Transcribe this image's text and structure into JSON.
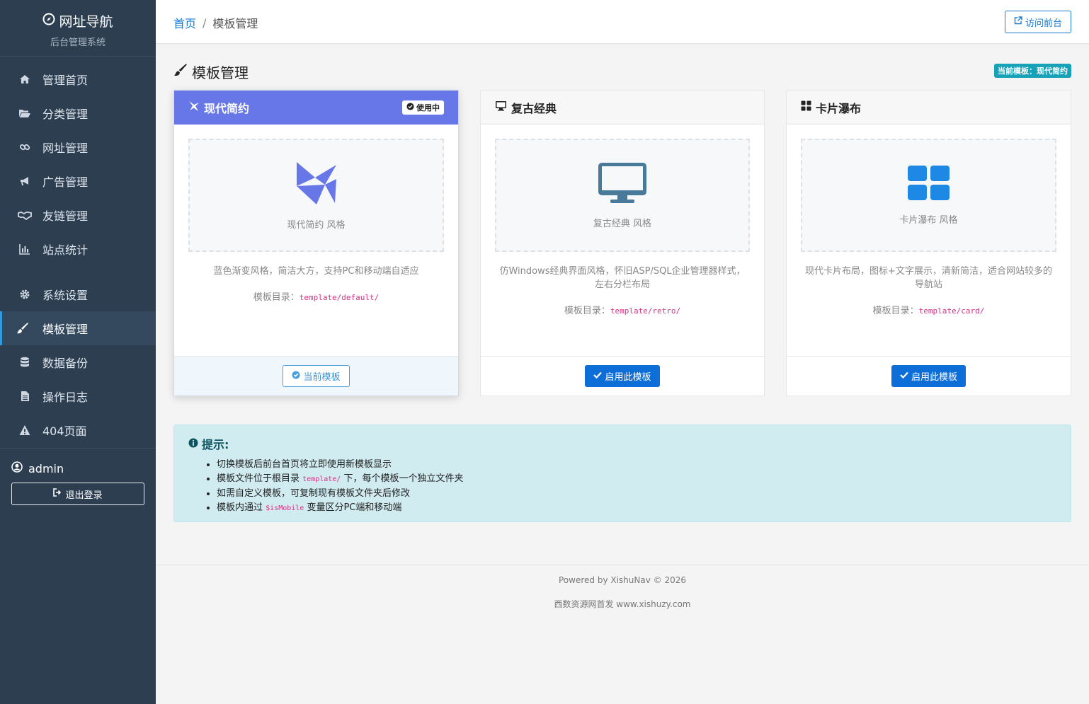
{
  "brand": {
    "title": "网址导航",
    "subtitle": "后台管理系统"
  },
  "nav": [
    {
      "label": "管理首页",
      "icon": "home-icon"
    },
    {
      "label": "分类管理",
      "icon": "folder-open-icon"
    },
    {
      "label": "网址管理",
      "icon": "link-icon"
    },
    {
      "label": "广告管理",
      "icon": "bullhorn-icon"
    },
    {
      "label": "友链管理",
      "icon": "handshake-icon"
    },
    {
      "label": "站点统计",
      "icon": "bar-chart-icon"
    },
    {
      "label": "系统设置",
      "icon": "gear-icon"
    },
    {
      "label": "模板管理",
      "icon": "paint-brush-icon",
      "active": true
    },
    {
      "label": "数据备份",
      "icon": "database-icon"
    },
    {
      "label": "操作日志",
      "icon": "file-text-icon"
    },
    {
      "label": "404页面",
      "icon": "warning-icon"
    }
  ],
  "user": {
    "name": "admin",
    "logout_label": "退出登录"
  },
  "header": {
    "breadcrumb_home": "首页",
    "breadcrumb_sep": "/",
    "breadcrumb_current": "模板管理",
    "visit_label": "访问前台"
  },
  "page": {
    "title": "模板管理",
    "current_badge": "当前模板：现代简约"
  },
  "templates": [
    {
      "name": "现代简约",
      "status_tag": "使用中",
      "preview_label": "现代简约 风格",
      "description": "蓝色渐变风格，简洁大方，支持PC和移动端自适应",
      "dir_label": "模板目录：",
      "dir_path": "template/default/",
      "button_label": "当前模板"
    },
    {
      "name": "复古经典",
      "preview_label": "复古经典 风格",
      "description": "仿Windows经典界面风格，怀旧ASP/SQL企业管理器样式，左右分栏布局",
      "dir_label": "模板目录：",
      "dir_path": "template/retro/",
      "button_label": "启用此模板"
    },
    {
      "name": "卡片瀑布",
      "preview_label": "卡片瀑布 风格",
      "description": "现代卡片布局，图标+文字展示，清新简洁，适合网站较多的导航站",
      "dir_label": "模板目录：",
      "dir_path": "template/card/",
      "button_label": "启用此模板"
    }
  ],
  "tip": {
    "title": "提示:",
    "items": [
      {
        "text": "切换模板后前台首页将立即使用新模板显示"
      },
      {
        "pre": "模板文件位于根目录 ",
        "code": "template/",
        "post": " 下，每个模板一个独立文件夹"
      },
      {
        "text": "如需自定义模板，可复制现有模板文件夹后修改"
      },
      {
        "pre": "模板内通过 ",
        "code": "$isMobile",
        "post": " 变量区分PC端和移动端"
      }
    ]
  },
  "footer": {
    "powered": "Powered by XishuNav © 2026",
    "source": "西数资源网首发 www.xishuzy.com"
  },
  "colors": {
    "sidebar_bg": "#2c3e50",
    "accent": "#6777e8",
    "primary": "#0d6ed7",
    "info": "#17a2b8"
  }
}
